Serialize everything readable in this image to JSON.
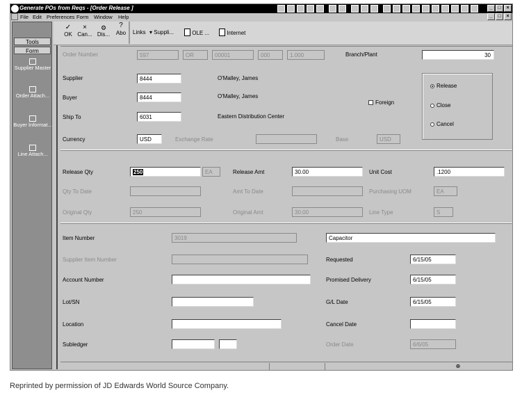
{
  "window": {
    "title": "Generate POs from Reqs - [Order Release ]",
    "buttons": {
      "minimize": "_",
      "restore": "□",
      "close": "×"
    }
  },
  "menu": [
    "File",
    "Edit",
    "Preferences",
    "Form",
    "Window",
    "Help"
  ],
  "toolbar": {
    "ok": "OK",
    "cancel": "Can...",
    "display": "Dis...",
    "about": "Abo",
    "links": "Links",
    "supplier": "Suppli...",
    "ole": "OLE ...",
    "internet": "Internet"
  },
  "left_panel": {
    "tabs": [
      "Tools",
      "Form"
    ],
    "items": [
      "Supplier Master",
      "Order Attach...",
      "Buyer Informat...",
      "Line Attach..."
    ]
  },
  "header": {
    "order_number_label": "Order Number",
    "order_number": "597",
    "order_type": "OR",
    "order_company": "00001",
    "order_suffix": "000",
    "order_line": "1.000",
    "branch_plant_label": "Branch/Plant",
    "branch_plant": "30",
    "supplier_label": "Supplier",
    "supplier": "8444",
    "supplier_name": "O'Malley, James",
    "buyer_label": "Buyer",
    "buyer": "8444",
    "buyer_name": "O'Malley, James",
    "ship_to_label": "Ship To",
    "ship_to": "6031",
    "ship_to_name": "Eastern Distribution Center",
    "currency_label": "Currency",
    "currency": "USD",
    "exchange_rate_label": "Exchange Rate",
    "exchange_rate": "",
    "base_label": "Base",
    "base": "USD",
    "foreign_label": "Foreign",
    "radio_release": "Release",
    "radio_close": "Close",
    "radio_cancel": "Cancel"
  },
  "quantities": {
    "release_qty_label": "Release Qty",
    "release_qty": "250",
    "release_uom": "EA",
    "release_amt_label": "Release Amt",
    "release_amt": "30.00",
    "unit_cost_label": "Unit Cost",
    "unit_cost": ".1200",
    "qty_to_date_label": "Qty To Date",
    "qty_to_date": "",
    "amt_to_date_label": "Amt To Date",
    "amt_to_date": "",
    "purchasing_uom_label": "Purchasing UOM",
    "purchasing_uom": "EA",
    "original_qty_label": "Original Qty",
    "original_qty": "250",
    "original_amt_label": "Original Amt",
    "original_amt": "30.00",
    "line_type_label": "Line Type",
    "line_type": "S"
  },
  "detail": {
    "item_number_label": "Item Number",
    "item_number": "3019",
    "item_description": "Capacitor",
    "supplier_item_label": "Supplier Item Number",
    "supplier_item": "",
    "requested_label": "Requested",
    "requested": "6/15/05",
    "account_number_label": "Account Number",
    "account_number": "",
    "promised_label": "Promised Delivery",
    "promised": "6/15/05",
    "lot_sn_label": "Lot/SN",
    "lot_sn": "",
    "gl_date_label": "G/L Date",
    "gl_date": "6/15/05",
    "location_label": "Location",
    "location": "",
    "cancel_date_label": "Cancel Date",
    "cancel_date": "",
    "subledger_label": "Subledger",
    "subledger": "",
    "subledger_type": "",
    "order_date_label": "Order Date",
    "order_date": "6/6/05"
  },
  "credit": "Reprinted by permission of JD Edwards World Source Company."
}
